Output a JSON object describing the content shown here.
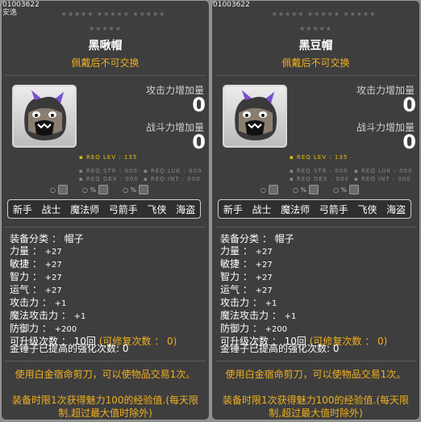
{
  "tooltips": [
    {
      "item_id": "01003622",
      "subtitle": "安逸",
      "stars_top": "★★★★★ ★★★★★ ★★★★★",
      "stars_bottom": "★★★★★",
      "name": "黑啾帽",
      "trade_note": "佩戴后不可交换",
      "attack_increase_label": "攻击力增加量",
      "attack_increase_value": "0",
      "power_increase_label": "战斗力增加量",
      "power_increase_value": "0",
      "req_lev": "▪ REQ LEV : 135",
      "req_str": "▪ REQ STR : 000",
      "req_luk": "▪ REQ LUK : 000",
      "req_dex": "▪ REQ DEX : 000",
      "req_int": "▪ REQ INT : 000",
      "slot_values": [
        "○",
        "○ %",
        "○ %"
      ],
      "classes": [
        "新手",
        "战士",
        "魔法师",
        "弓箭手",
        "飞侠",
        "海盗"
      ],
      "stats": {
        "category_label": "装备分类 ：",
        "category_value": "帽子",
        "str_label": "力量 ：",
        "str_value": "+27",
        "dex_label": "敏捷 ：",
        "dex_value": "+27",
        "int_label": "智力 ：",
        "int_value": "+27",
        "luk_label": "运气 ：",
        "luk_value": "+27",
        "atk_label": "攻击力 ：",
        "atk_value": "+1",
        "matk_label": "魔法攻击力 ：",
        "matk_value": "+1",
        "def_label": "防御力 ：",
        "def_value": "+200",
        "upgrade_label": "可升级次数 ： 10回",
        "repair_label": "(可修复次数 ： 0)",
        "hammer_label": "金锤子已提高的强化次数: 0"
      },
      "bottom_note_1": "使用白金宿命剪刀，可以使物品交易1次。",
      "bottom_note_2": "装备时限1次获得魅力100的经验值.(每天限制,超过最大值时除外)"
    },
    {
      "item_id": "01003622",
      "subtitle": "",
      "stars_top": "★★★★★ ★★★★★ ★★★★★",
      "stars_bottom": "★★★★★",
      "name": "黑豆帽",
      "trade_note": "佩戴后不可交换",
      "attack_increase_label": "攻击力增加量",
      "attack_increase_value": "0",
      "power_increase_label": "战斗力增加量",
      "power_increase_value": "0",
      "req_lev": "▪ REQ LEV : 135",
      "req_str": "▪ REQ STR : 000",
      "req_luk": "▪ REQ LUK : 000",
      "req_dex": "▪ REQ DEX : 000",
      "req_int": "▪ REQ INT : 000",
      "slot_values": [
        "○",
        "○ %",
        "○ %"
      ],
      "classes": [
        "新手",
        "战士",
        "魔法师",
        "弓箭手",
        "飞侠",
        "海盗"
      ],
      "stats": {
        "category_label": "装备分类 ：",
        "category_value": "帽子",
        "str_label": "力量 ：",
        "str_value": "+27",
        "dex_label": "敏捷 ：",
        "dex_value": "+27",
        "int_label": "智力 ：",
        "int_value": "+27",
        "luk_label": "运气 ：",
        "luk_value": "+27",
        "atk_label": "攻击力 ：",
        "atk_value": "+1",
        "matk_label": "魔法攻击力 ：",
        "matk_value": "+1",
        "def_label": "防御力 ：",
        "def_value": "+200",
        "upgrade_label": "可升级次数 ： 10回",
        "repair_label": "(可修复次数 ： 0)",
        "hammer_label": "金锤子已提高的强化次数: 0"
      },
      "bottom_note_1": "使用白金宿命剪刀，可以使物品交易1次。",
      "bottom_note_2": "装备时限1次获得魅力100的经验值.(每天限制,超过最大值时除外)"
    }
  ],
  "icon_names": {
    "item": "black-hat-monster-icon",
    "slot1": "scroll-icon",
    "slot2": "potential-icon",
    "slot3": "armor-icon"
  }
}
